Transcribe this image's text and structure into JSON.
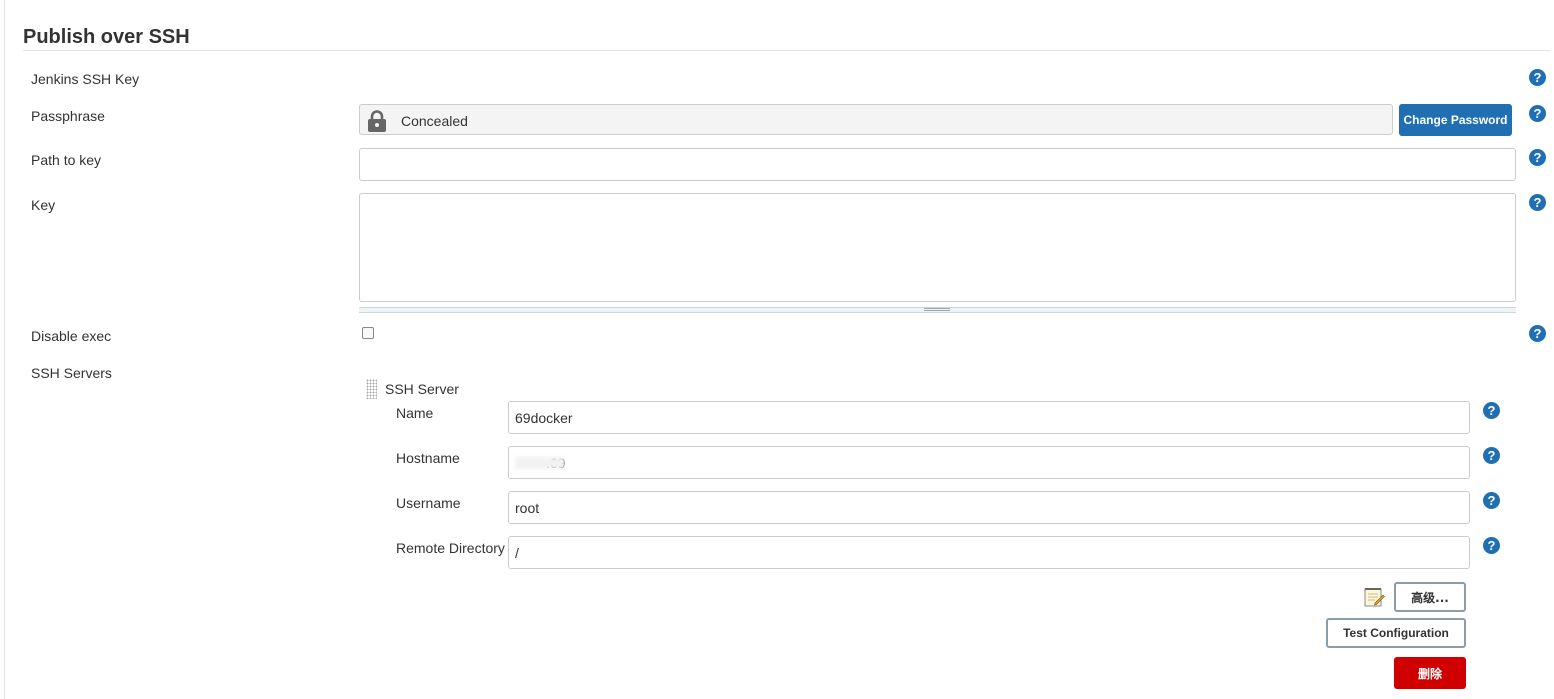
{
  "section": {
    "title": "Publish over SSH"
  },
  "fields": {
    "jenkins_ssh_key": {
      "label": "Jenkins SSH Key"
    },
    "passphrase": {
      "label": "Passphrase",
      "value": "Concealed",
      "button": "Change Password"
    },
    "path_to_key": {
      "label": "Path to key",
      "value": ""
    },
    "key": {
      "label": "Key",
      "value": ""
    },
    "disable_exec": {
      "label": "Disable exec",
      "checked": false
    },
    "ssh_servers": {
      "label": "SSH Servers"
    }
  },
  "server": {
    "title": "SSH Server",
    "name": {
      "label": "Name",
      "value": "69docker"
    },
    "hostname": {
      "label": "Hostname",
      "value": "        .69"
    },
    "username": {
      "label": "Username",
      "value": "root"
    },
    "remote_directory": {
      "label": "Remote Directory",
      "value": "/"
    },
    "buttons": {
      "advanced": "高级...",
      "test": "Test Configuration",
      "delete": "删除"
    }
  },
  "help": {
    "glyph": "?"
  },
  "colors": {
    "primary": "#1f6fb2",
    "danger": "#d00000"
  },
  "icons": {
    "lock": "lock-icon",
    "help": "help-icon",
    "notepad": "notepad-icon",
    "drag": "drag-handle-icon"
  }
}
